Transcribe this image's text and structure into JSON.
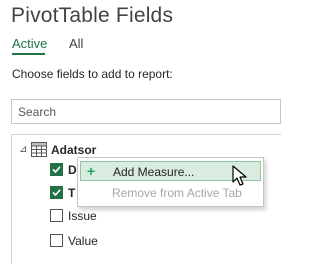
{
  "pane": {
    "title": "PivotTable Fields",
    "tabs": [
      {
        "label": "Active",
        "active": true
      },
      {
        "label": "All",
        "active": false
      }
    ],
    "instruction": "Choose fields to add to report:"
  },
  "search": {
    "placeholder": "Search",
    "value": ""
  },
  "field_list": {
    "table": {
      "name": "Adatsor",
      "expanded": true,
      "toggle_glyph": "⊿",
      "icon": "table-icon"
    },
    "fields": [
      {
        "label": "D",
        "checked": true
      },
      {
        "label": "T",
        "checked": true
      },
      {
        "label": "Issue",
        "checked": false
      },
      {
        "label": "Value",
        "checked": false
      }
    ]
  },
  "context_menu": {
    "items": [
      {
        "label": "Add Measure...",
        "icon": "plus-icon",
        "icon_glyph": "+",
        "enabled": true,
        "hovered": true
      },
      {
        "label": "Remove from Active Tab",
        "enabled": false,
        "hovered": false
      }
    ]
  },
  "colors": {
    "accent_green": "#217346",
    "menu_hover_bg": "#d9ecdf",
    "menu_hover_border": "#8fc7a2",
    "plus_green": "#21a366",
    "disabled_text": "#a6a6a6"
  }
}
